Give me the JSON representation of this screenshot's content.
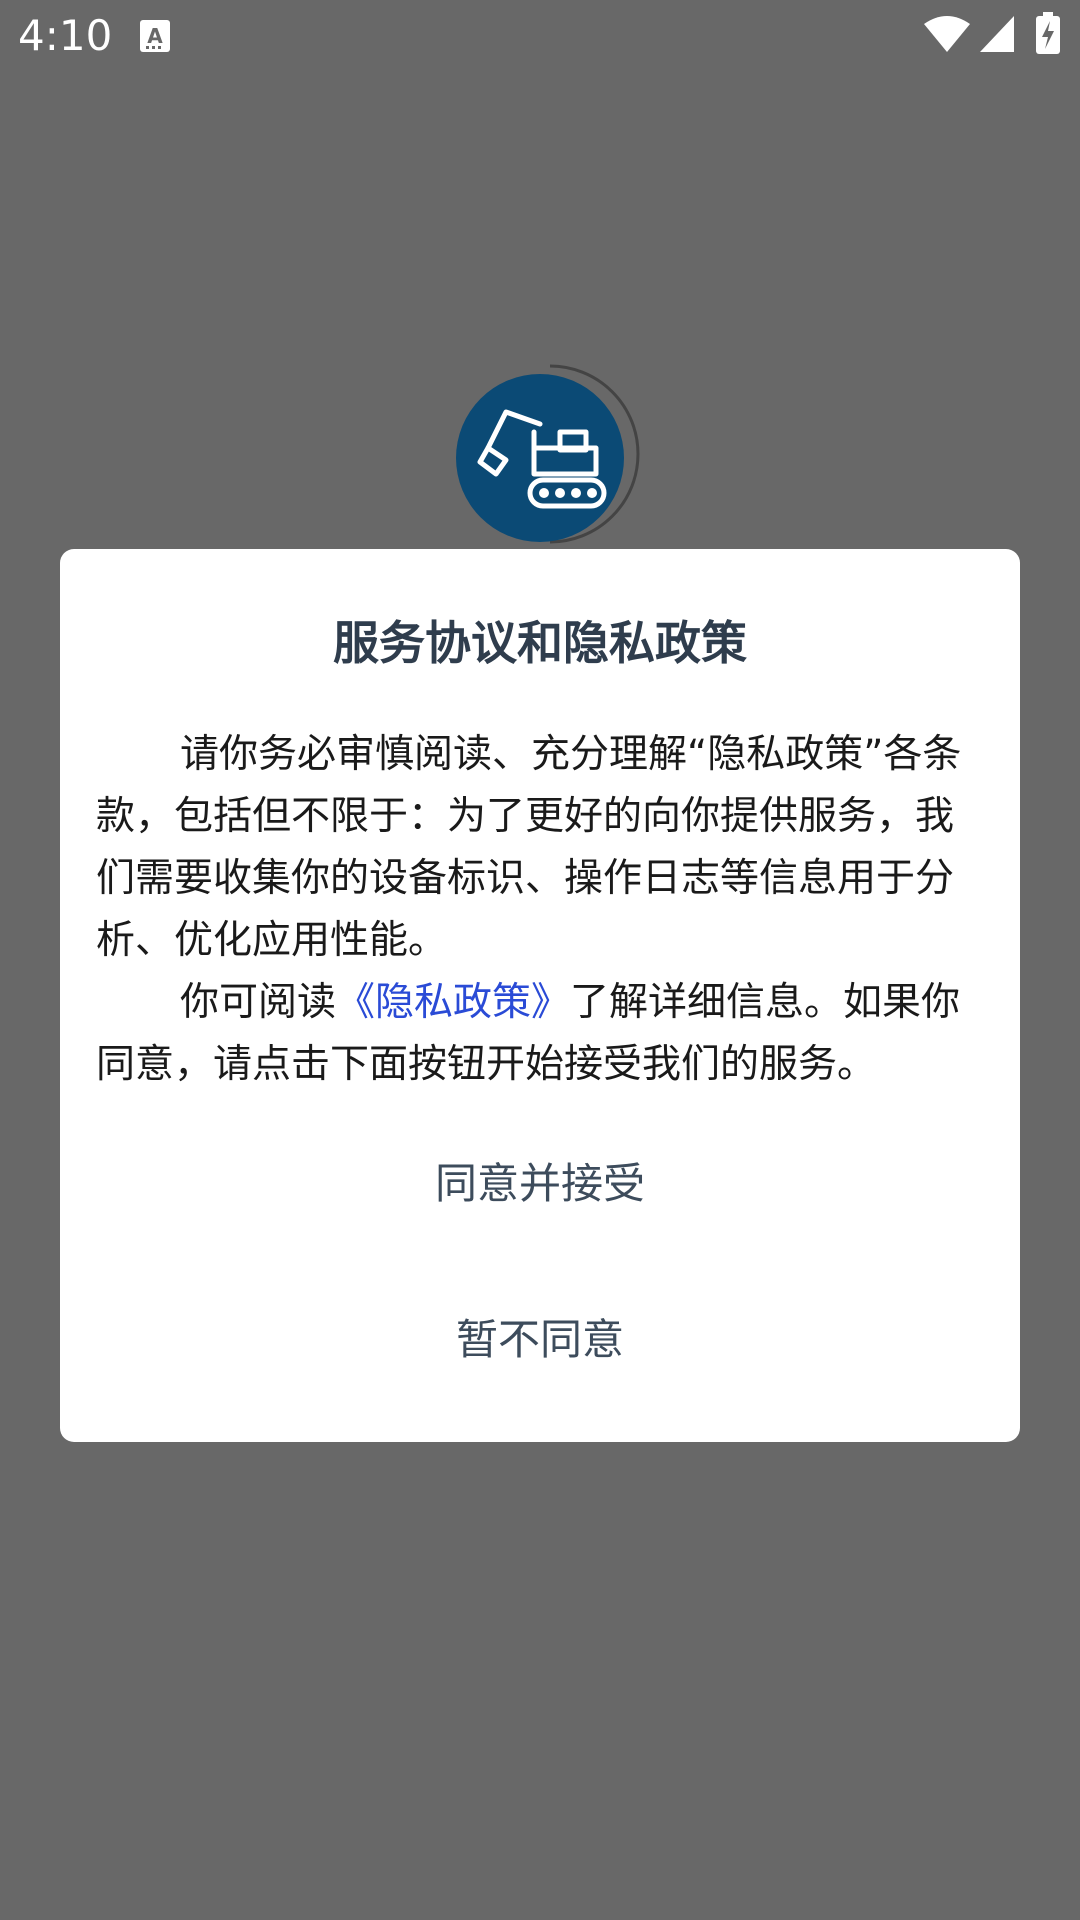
{
  "status_bar": {
    "time": "4:10",
    "icons": [
      "notification-a-icon",
      "wifi-icon",
      "cell-signal-icon",
      "battery-charging-icon"
    ]
  },
  "app_logo": {
    "icon": "excavator-icon",
    "color": "#0b4a75"
  },
  "dialog": {
    "title": "服务协议和隐私政策",
    "paragraph1": "请你务必审慎阅读、充分理解“隐私政策”各条款，包括但不限于：为了更好的向你提供服务，我们需要收集你的设备标识、操作日志等信息用于分析、优化应用性能。",
    "paragraph2_prefix": "你可阅读",
    "policy_link": "《隐私政策》",
    "paragraph2_suffix": "了解详细信息。如果你同意，请点击下面按钮开始接受我们的服务。",
    "agree_label": "同意并接受",
    "decline_label": "暂不同意",
    "link_color": "#2a4bd6"
  }
}
